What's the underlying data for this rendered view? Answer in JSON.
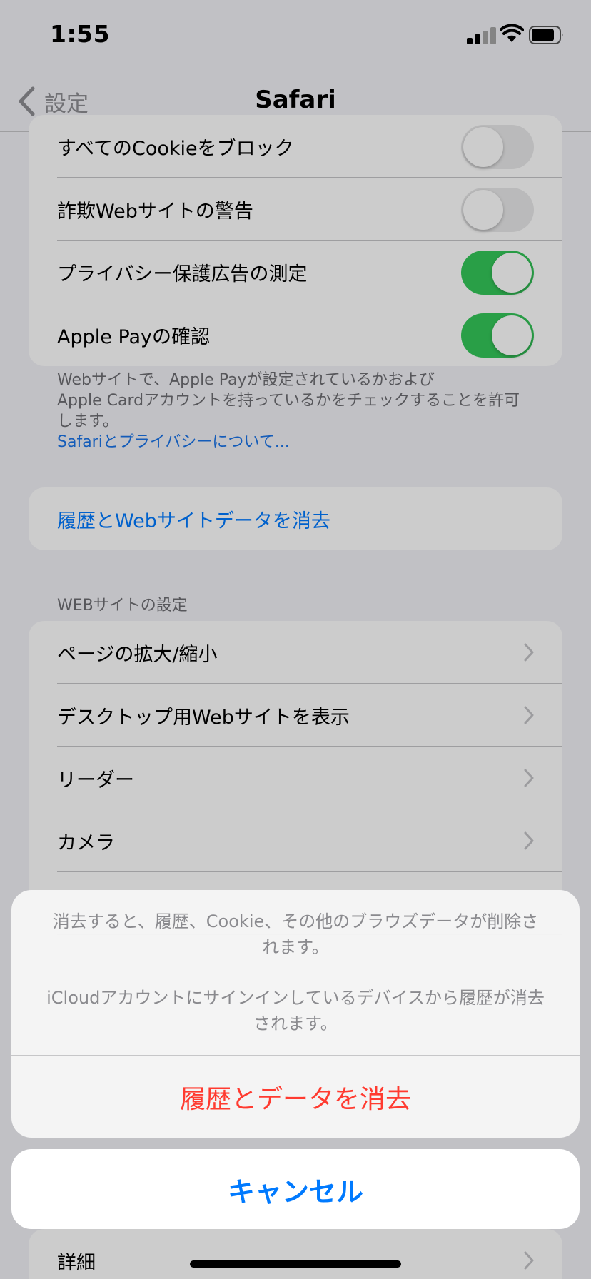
{
  "status": {
    "time": "1:55"
  },
  "nav": {
    "back_label": "設定",
    "title": "Safari"
  },
  "privacy": {
    "rows": [
      {
        "label": "すべてのCookieをブロック",
        "toggle_on": false
      },
      {
        "label": "詐欺Webサイトの警告",
        "toggle_on": false
      },
      {
        "label": "プライバシー保護広告の測定",
        "toggle_on": true
      },
      {
        "label": "Apple Payの確認",
        "toggle_on": true
      }
    ],
    "footer_line1": "Webサイトで、Apple Payが設定されているかおよび",
    "footer_line2": "Apple Cardアカウントを持っているかをチェックすることを許可",
    "footer_line3": "します。",
    "footer_link": "Safariとプライバシーについて..."
  },
  "clear_history": {
    "label": "履歴とWebサイトデータを消去"
  },
  "website_settings": {
    "header": "WEBサイトの設定",
    "items": [
      {
        "label": "ページの拡大/縮小"
      },
      {
        "label": "デスクトップ用Webサイトを表示"
      },
      {
        "label": "リーダー"
      },
      {
        "label": "カメラ"
      }
    ]
  },
  "advanced": {
    "label": "詳細"
  },
  "action_sheet": {
    "message1_line1": "消去すると、履歴、Cookie、その他のブラウズデータが削除さ",
    "message1_line2": "れます。",
    "message2_line1": "iCloudアカウントにサインインしているデバイスから履歴が消去",
    "message2_line2": "されます。",
    "destructive_label": "履歴とデータを消去",
    "cancel_label": "キャンセル"
  },
  "colors": {
    "accent": "#007aff",
    "destructive": "#ff3b30",
    "toggle_on": "#34c759",
    "secondary_text": "#8e8e93"
  },
  "icons": [
    "chevron-left-icon",
    "cellular-signal-icon",
    "wifi-icon",
    "battery-icon",
    "chevron-right-icon"
  ]
}
